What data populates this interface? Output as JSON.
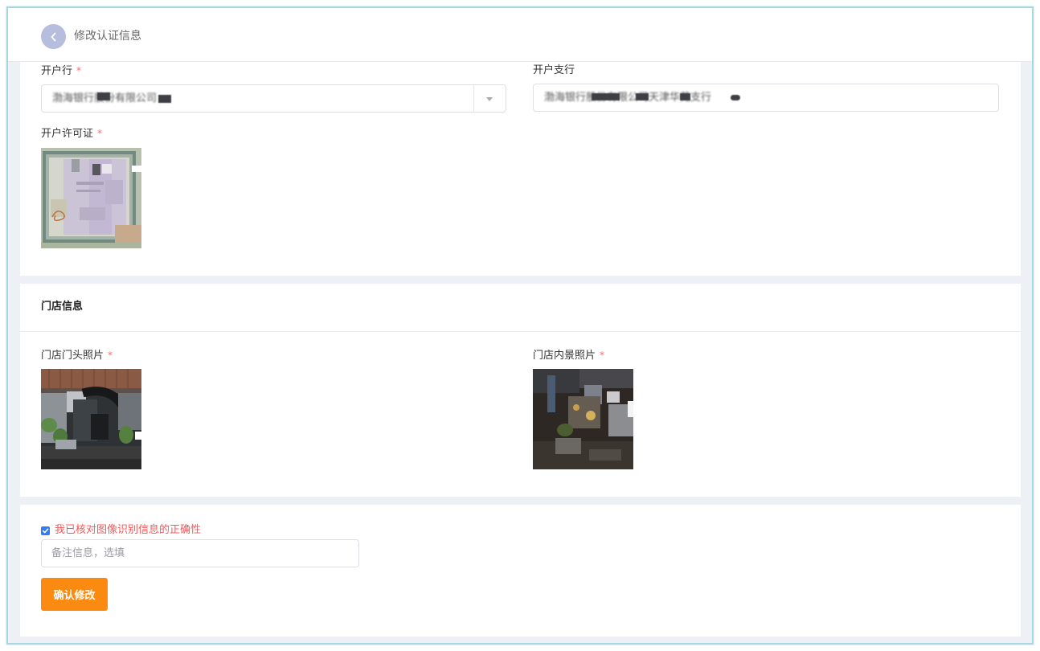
{
  "header": {
    "title": "修改认证信息",
    "back_icon": "chevron-left-icon"
  },
  "bank_card": {
    "bank_label": "开户行",
    "bank_value": "渤海银行股份有限公司",
    "bank_select_icon": "caret-down-icon",
    "branch_label": "开户支行",
    "branch_value": "渤海银行股份有限公司天津华苑支行",
    "license_label": "开户许可证"
  },
  "store_card": {
    "title": "门店信息",
    "front_photo_label": "门店门头照片",
    "interior_photo_label": "门店内景照片"
  },
  "confirm_card": {
    "checkbox_checked": true,
    "checkbox_icon": "checkmark-icon",
    "checkbox_label": "我已核对图像识别信息的正确性",
    "remark_placeholder": "备注信息，选填",
    "remark_value": "",
    "submit_label": "确认修改"
  },
  "required_mark": "*",
  "colors": {
    "frame_border": "#a9d7e0",
    "page_bg": "#edf0f4",
    "back_btn": "#b7bedd",
    "required": "#f56c6c",
    "checkbox": "#2f7cf6",
    "checkbox_label": "#f4585a",
    "submit": "#fb8b10"
  }
}
